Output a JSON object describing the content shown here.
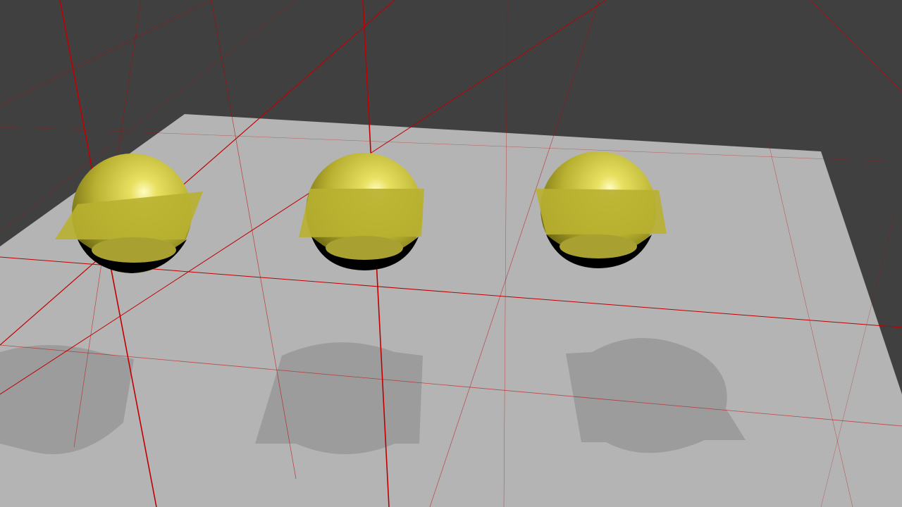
{
  "scene": {
    "colors": {
      "background": "#404040",
      "floor": "#b4b4b4",
      "shadow": "#999999",
      "sphere": "#d8d040",
      "sphere_dark": "#6e6a10",
      "plane": "#b8b030",
      "grid_line": "#c00000"
    },
    "objects": [
      "sphere-left",
      "sphere-center",
      "sphere-right"
    ]
  }
}
